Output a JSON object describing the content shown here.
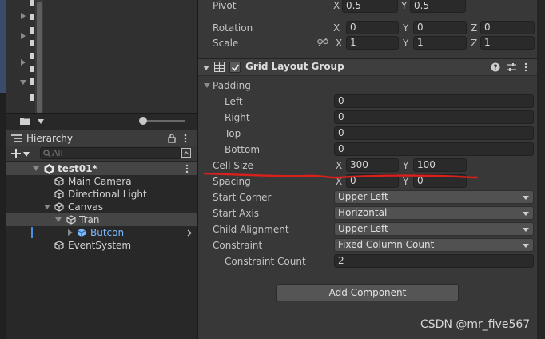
{
  "transform": {
    "pivot": {
      "label": "Pivot",
      "x": "0.5",
      "y": "0.5"
    },
    "rotation": {
      "label": "Rotation",
      "x": "0",
      "y": "0",
      "z": "0"
    },
    "scale": {
      "label": "Scale",
      "x": "1",
      "y": "1",
      "z": "1"
    },
    "axis": {
      "x": "X",
      "y": "Y",
      "z": "Z"
    }
  },
  "grid_layout": {
    "title": "Grid Layout Group",
    "enabled": true,
    "padding": {
      "label": "Padding",
      "left": {
        "label": "Left",
        "value": "0"
      },
      "right": {
        "label": "Right",
        "value": "0"
      },
      "top": {
        "label": "Top",
        "value": "0"
      },
      "bottom": {
        "label": "Bottom",
        "value": "0"
      }
    },
    "cell_size": {
      "label": "Cell Size",
      "x": "300",
      "y": "100"
    },
    "spacing": {
      "label": "Spacing",
      "x": "0",
      "y": "0"
    },
    "start_corner": {
      "label": "Start Corner",
      "value": "Upper Left"
    },
    "start_axis": {
      "label": "Start Axis",
      "value": "Horizontal"
    },
    "child_alignment": {
      "label": "Child Alignment",
      "value": "Upper Left"
    },
    "constraint": {
      "label": "Constraint",
      "value": "Fixed Column Count"
    },
    "constraint_count": {
      "label": "Constraint Count",
      "value": "2"
    }
  },
  "add_component": "Add Component",
  "hierarchy": {
    "tab_label": "Hierarchy",
    "search_placeholder": "All",
    "items": [
      {
        "label": "test01*"
      },
      {
        "label": "Main Camera"
      },
      {
        "label": "Directional Light"
      },
      {
        "label": "Canvas"
      },
      {
        "label": "Tran"
      },
      {
        "label": "Butcon"
      },
      {
        "label": "EventSystem"
      }
    ]
  },
  "watermark": "CSDN @mr_five567",
  "colors": {
    "annotation": "#d9201c",
    "selected_row": "#2c5d87",
    "highlight_row": "#454545",
    "prefab_blue": "#7ab8ff"
  }
}
